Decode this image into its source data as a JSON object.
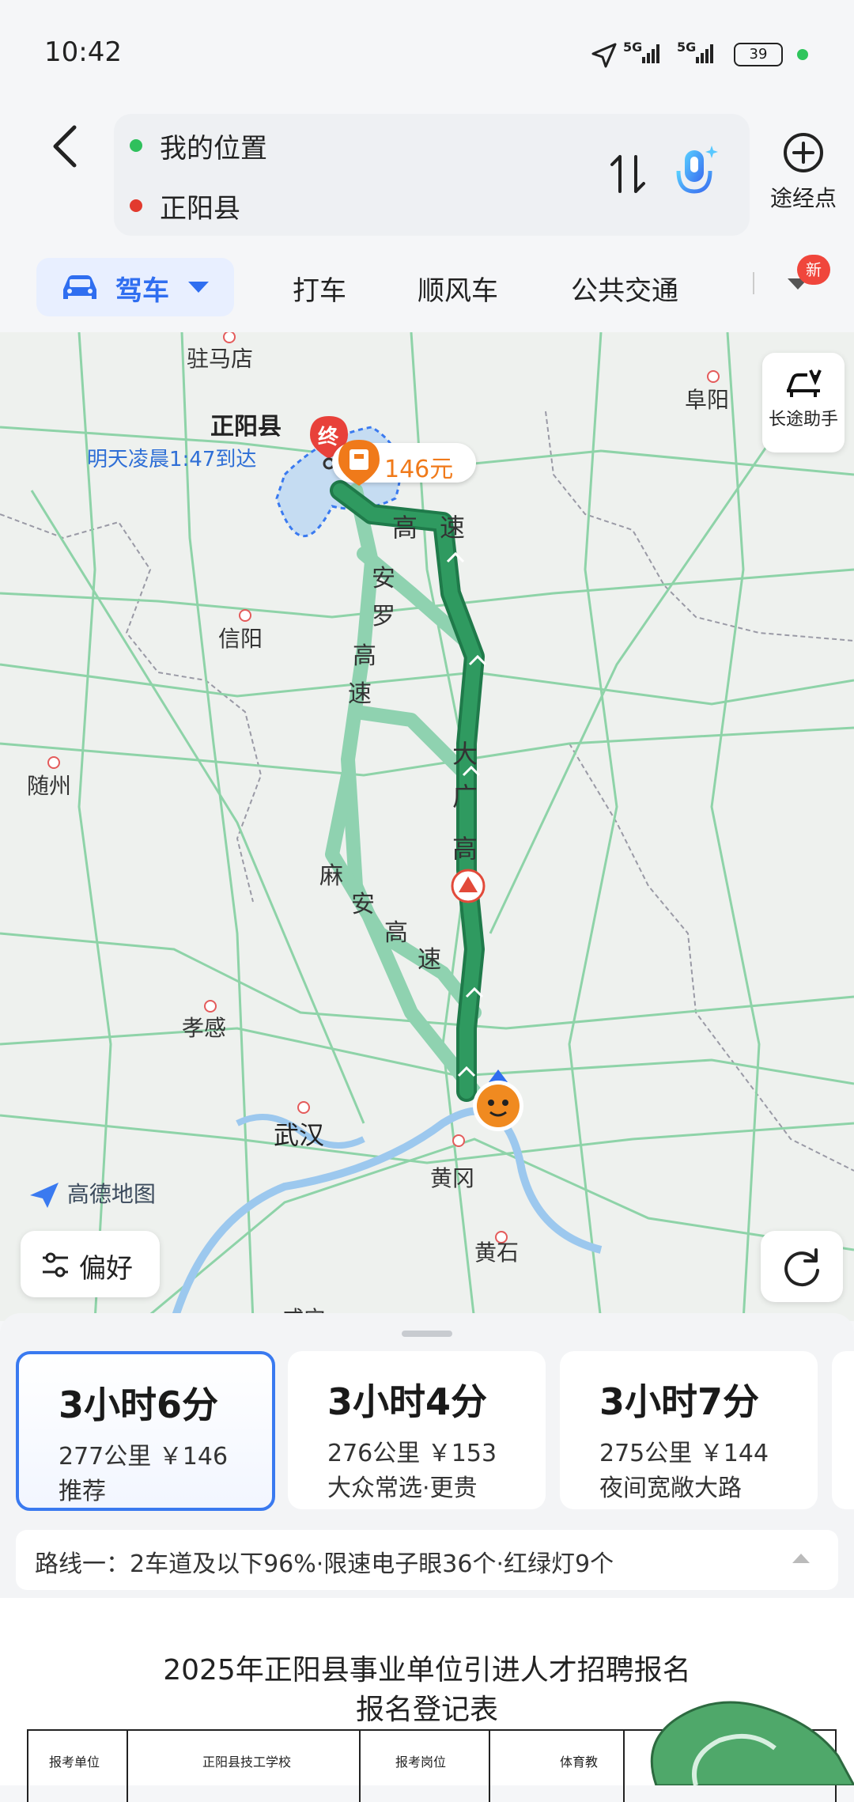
{
  "status_bar": {
    "time": "10:42",
    "network1": "5G",
    "network2": "5G",
    "battery": "39"
  },
  "route": {
    "origin": "我的位置",
    "destination": "正阳县",
    "waypoint_label": "途经点"
  },
  "modes": {
    "items": [
      "驾车",
      "打车",
      "顺风车",
      "公共交通"
    ],
    "badge": "新"
  },
  "map": {
    "cities": {
      "zhumadian": "驻马店",
      "zhengyang": "正阳县",
      "fuyang": "阜阳",
      "xinyang": "信阳",
      "suizhou": "随州",
      "xiaogan": "孝感",
      "wuhan": "武汉",
      "huanggang": "黄冈",
      "huangshi": "黄石",
      "bottom_partial": "咸宁"
    },
    "arrival": "明天凌晨1:47到达",
    "end_marker": "终",
    "toll": "146元",
    "highway_labels": {
      "h1_a": "高",
      "h1_b": "速",
      "anluo": [
        "安",
        "罗",
        "高",
        "速"
      ],
      "daguang": [
        "大",
        "广",
        "高"
      ],
      "maan": [
        "麻",
        "安",
        "高",
        "速"
      ]
    },
    "long_trip_assistant": "长途助手",
    "preference": "偏好",
    "logo": "高德地图"
  },
  "routes": [
    {
      "time": "3小时6分",
      "detail": "277公里 ￥146",
      "tag": "推荐",
      "selected": true
    },
    {
      "time": "3小时4分",
      "detail": "276公里 ￥153",
      "tag": "大众常选·更贵",
      "selected": false
    },
    {
      "time": "3小时7分",
      "detail": "275公里 ￥144",
      "tag": "夜间宽敞大路",
      "selected": false
    }
  ],
  "route_info": "路线一：2车道及以下96%·限速电子眼36个·红绿灯9个",
  "document": {
    "title1": "2025年正阳县事业单位引进人才招聘报名",
    "title2": "报名登记表",
    "cells": [
      "报考单位",
      "正阳县技工学校",
      "报考岗位",
      "体育教"
    ]
  },
  "colors": {
    "accent": "#3a7af0",
    "route_main": "#2e8b57",
    "route_alt": "#8fd2b0"
  }
}
